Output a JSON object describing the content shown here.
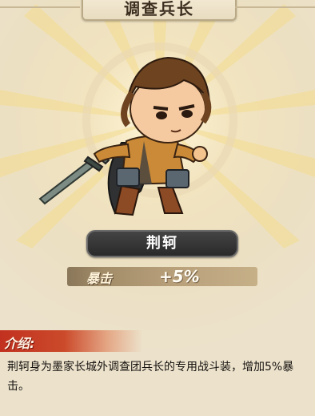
{
  "panel": {
    "title": "调查兵长",
    "character_name": "荆轲",
    "stat": {
      "label": "暴击",
      "value": "+5%"
    },
    "intro": {
      "label": "介绍:",
      "text": "荆轲身为墨家长城外调查团兵长的专用战斗装，增加5%暴击。"
    }
  },
  "colors": {
    "background": "#ece2cc",
    "burst": "#f7e6a5",
    "name_plate": "#333333",
    "intro_header": "#c2311f"
  },
  "icons": {
    "character": "chibi-soldier-with-blades"
  }
}
